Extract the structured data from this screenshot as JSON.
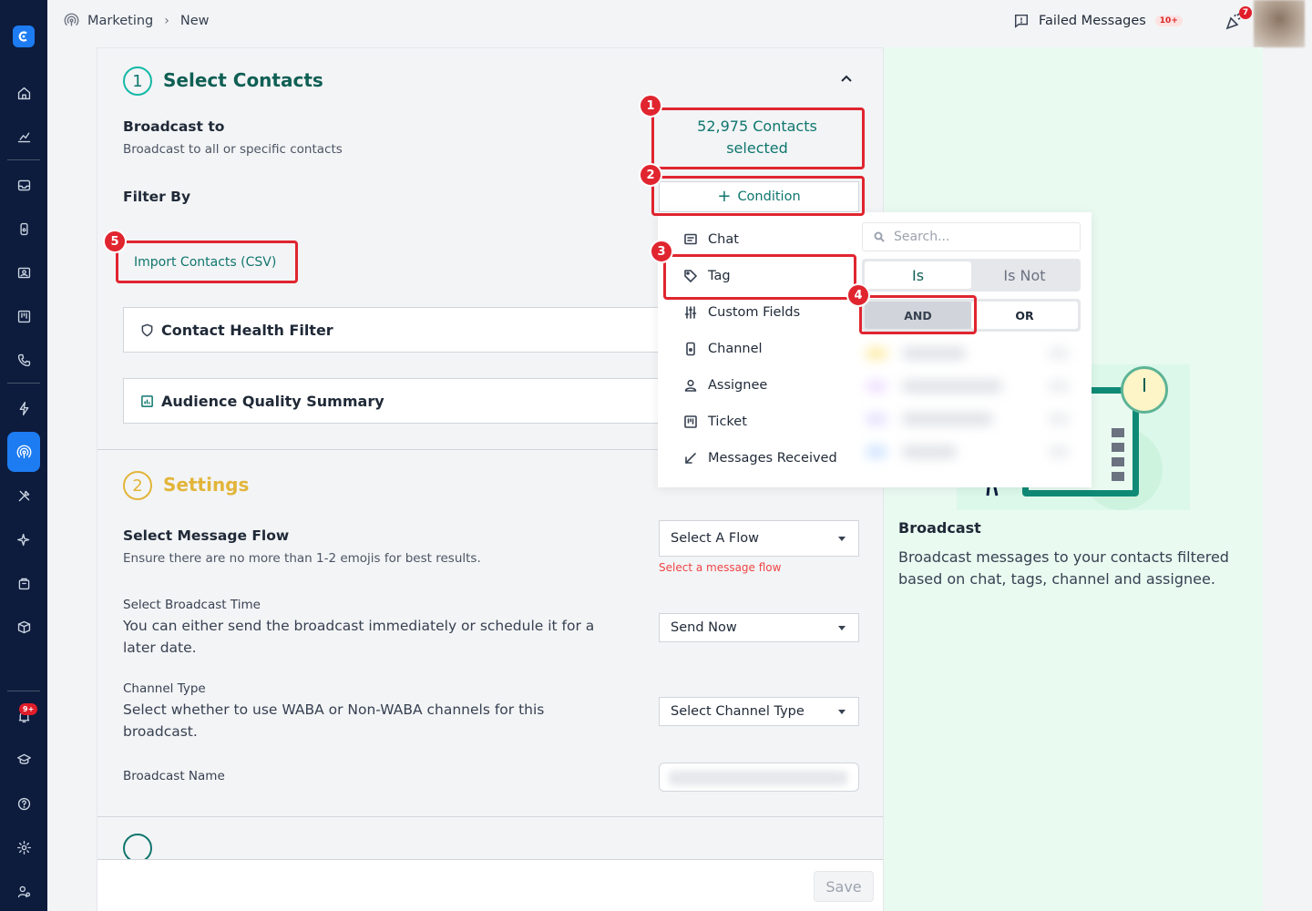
{
  "breadcrumb": {
    "section": "Marketing",
    "current": "New"
  },
  "header": {
    "failed_messages_label": "Failed Messages",
    "failed_messages_count": "10+",
    "megaphone_badge": "7"
  },
  "sidebar": {
    "notification_badge": "9+"
  },
  "select_contacts": {
    "step_number": "1",
    "title": "Select Contacts",
    "broadcast_to_label": "Broadcast to",
    "broadcast_to_desc": "Broadcast to all or specific contacts",
    "contacts_selected_line1": "52,975 Contacts",
    "contacts_selected_line2": "selected",
    "filter_by_label": "Filter By",
    "condition_button": "Condition",
    "import_contacts_link": "Import Contacts (CSV)",
    "contact_health_filter": "Contact Health Filter",
    "audience_quality_summary": "Audience Quality Summary"
  },
  "settings": {
    "step_number": "2",
    "title": "Settings",
    "message_flow_label": "Select Message Flow",
    "message_flow_desc": "Ensure there are no more than 1-2 emojis for best results.",
    "message_flow_select": "Select A Flow",
    "message_flow_error": "Select a message flow",
    "broadcast_time_label": "Select Broadcast Time",
    "broadcast_time_desc_line1": "You can either send the broadcast immediately or schedule it for a",
    "broadcast_time_desc_line2": "later date.",
    "broadcast_time_select": "Send Now",
    "channel_type_label": "Channel Type",
    "channel_type_desc_line1": "Select whether to use WABA or Non-WABA channels for this",
    "channel_type_desc_line2": "broadcast.",
    "channel_type_select": "Select Channel Type",
    "broadcast_name_label": "Broadcast Name"
  },
  "footer": {
    "save_button": "Save"
  },
  "right_panel": {
    "title": "Broadcast",
    "description": "Broadcast messages to your contacts filtered based on chat, tags, channel and assignee."
  },
  "condition_dropdown": {
    "items": [
      "Chat",
      "Tag",
      "Custom Fields",
      "Channel",
      "Assignee",
      "Ticket",
      "Messages Received"
    ],
    "search_placeholder": "Search...",
    "is_label": "Is",
    "is_not_label": "Is Not",
    "and_label": "AND",
    "or_label": "OR"
  },
  "annotations": [
    "1",
    "2",
    "3",
    "4",
    "5"
  ],
  "colors": {
    "accent_teal": "#0f766e",
    "brand_blue": "#1d7cf2",
    "sidebar_bg": "#0d1b3d",
    "highlight_red": "#e0252f",
    "settings_yellow": "#e2b53a"
  }
}
